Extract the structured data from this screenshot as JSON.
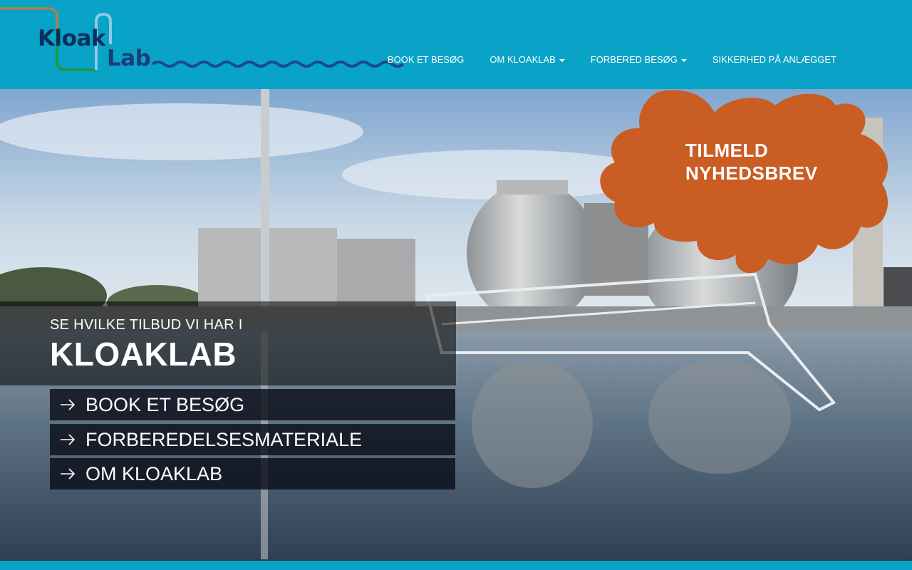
{
  "logo": {
    "part1": "Kloak",
    "part2": "Lab"
  },
  "nav": {
    "items": [
      {
        "label": "BOOK ET BESØG",
        "dropdown": false
      },
      {
        "label": "OM KLOAKLAB",
        "dropdown": true
      },
      {
        "label": "FORBERED BESØG",
        "dropdown": true
      },
      {
        "label": "SIKKERHED PÅ ANLÆGGET",
        "dropdown": false
      }
    ]
  },
  "hero": {
    "subtitle": "SE HVILKE TILBUD VI HAR I",
    "title": "KLOAKLAB",
    "ctas": [
      {
        "label": "BOOK ET BESØG"
      },
      {
        "label": "FORBEREDELSESMATERIALE"
      },
      {
        "label": "OM KLOAKLAB"
      }
    ]
  },
  "newsletter": {
    "line1": "TILMELD",
    "line2": "NYHEDSBREV"
  },
  "colors": {
    "header": "#08a3c6",
    "splash": "#c95d23",
    "logo_dark": "#0b2e5c",
    "logo_green": "#1a9a4a"
  }
}
